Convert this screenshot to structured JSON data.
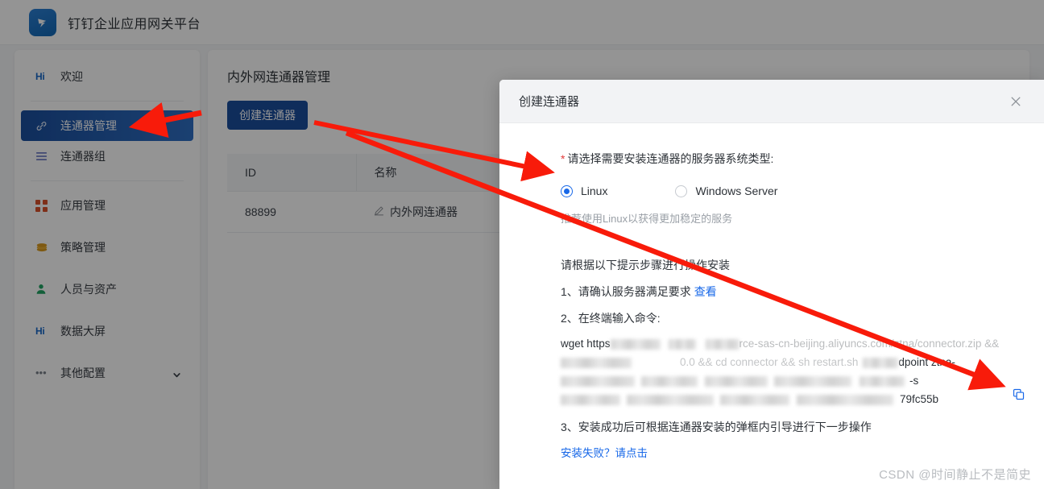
{
  "header": {
    "logo_icon": "dingtalk-logo-icon",
    "title": "钉钉企业应用网关平台"
  },
  "sidebar": {
    "items": [
      {
        "label": "欢迎",
        "icon": "hi-icon",
        "active": false
      },
      {
        "label": "连通器管理",
        "icon": "link-icon",
        "active": true
      },
      {
        "label": "连通器组",
        "icon": "list-icon",
        "active": false
      },
      {
        "label": "应用管理",
        "icon": "grid-icon",
        "active": false
      },
      {
        "label": "策略管理",
        "icon": "layers-icon",
        "active": false
      },
      {
        "label": "人员与资产",
        "icon": "user-icon",
        "active": false
      },
      {
        "label": "数据大屏",
        "icon": "hi-icon",
        "active": false
      },
      {
        "label": "其他配置",
        "icon": "dots-icon",
        "active": false,
        "expandable": true
      }
    ]
  },
  "main": {
    "page_title": "内外网连通器管理",
    "create_button": "创建连通器",
    "table": {
      "columns": [
        "ID",
        "名称"
      ],
      "rows": [
        {
          "id": "88899",
          "name": "内外网连通器",
          "edit_icon": "pencil-icon"
        }
      ]
    }
  },
  "modal": {
    "title": "创建连通器",
    "close_icon": "close-icon",
    "field_label": "请选择需要安装连通器的服务器系统类型:",
    "required_mark": "*",
    "options": [
      {
        "label": "Linux",
        "checked": true
      },
      {
        "label": "Windows Server",
        "checked": false
      }
    ],
    "hint": "推荐使用Linux以获得更加稳定的服务",
    "steps_intro": "请根据以下提示步骤进行操作安装",
    "step1_text": "1、请确认服务器满足要求",
    "step1_link": "查看",
    "step2_text": "2、在终端输入命令:",
    "command": {
      "line1_prefix": "wget https",
      "line1_mid": "rce-sas-cn-beijing.aliyuncs.com/ztna/connector.zip &&",
      "line2_mid": "0.0 && cd connector && sh restart.sh",
      "line2_suffix": "dpoint ztna-",
      "line3_suffix": "-s",
      "line4_suffix": "79fc55b",
      "copy_icon": "copy-icon"
    },
    "step3_text": "3、安装成功后可根据连通器安装的弹框内引导进行下一步操作",
    "fail_link": "安装失败？请点击"
  },
  "watermark": "CSDN @时间静止不是简史",
  "colors": {
    "primary": "#1b4f9e",
    "link": "#1868e8",
    "annotation": "#f81b0a",
    "required": "#e33b3b"
  }
}
